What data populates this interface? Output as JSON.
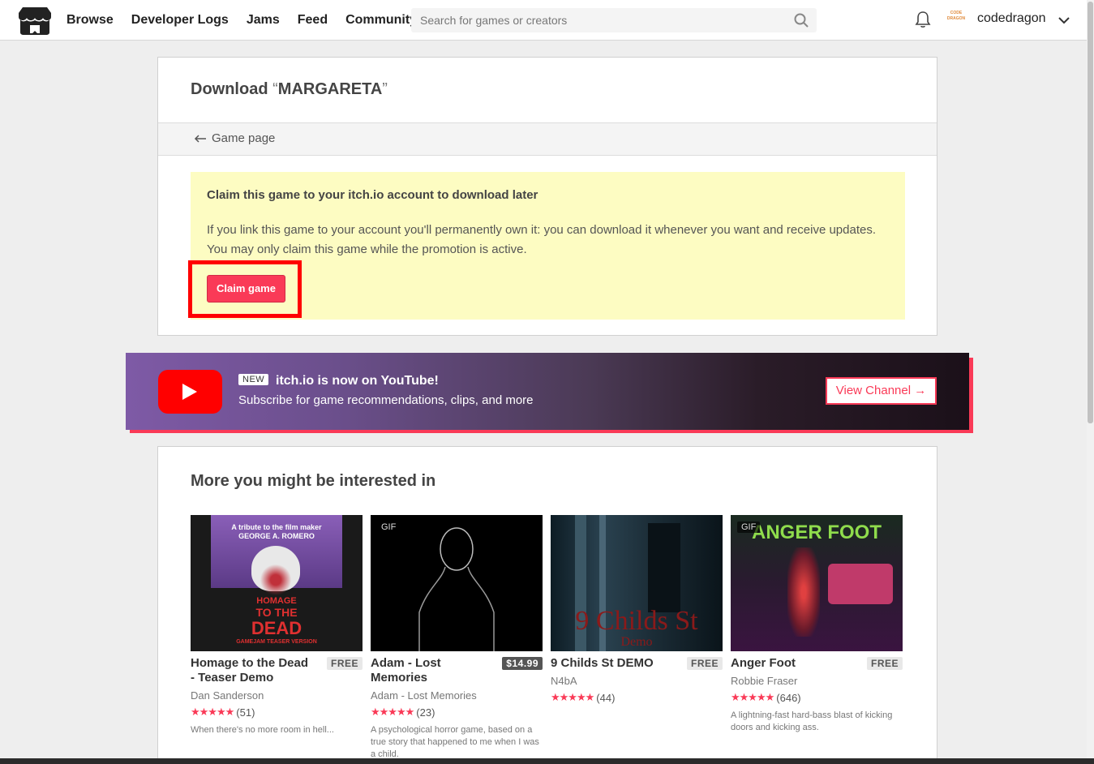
{
  "header": {
    "nav": [
      "Browse",
      "Developer Logs",
      "Jams",
      "Feed",
      "Community"
    ],
    "search_placeholder": "Search for games or creators",
    "username": "codedragon",
    "avatar_text": "CODE DRAGON"
  },
  "download": {
    "title_prefix": "Download ",
    "open_quote": "“",
    "game_name": "MARGARETA",
    "close_quote": "”",
    "back_link": "Game page",
    "claim_heading": "Claim this game to your itch.io account to download later",
    "claim_text": "If you link this game to your account you'll permanently own it: you can download it whenever you want and receive updates. You may only claim this game while the promotion is active.",
    "claim_button": "Claim game"
  },
  "youtube": {
    "badge": "NEW",
    "heading": "itch.io is now on YouTube!",
    "subtext": "Subscribe for game recommendations, clips, and more",
    "button": "View Channel →"
  },
  "more": {
    "title": "More you might be interested in",
    "games": [
      {
        "title": "Homage to the Dead - Teaser Demo",
        "price": "FREE",
        "author": "Dan Sanderson",
        "rating_count": "(51)",
        "rating": 4.5,
        "description": "When there's no more room in hell...",
        "gif": "",
        "cover_line1": "A tribute to the film maker",
        "cover_line2": "GEORGE A. ROMERO",
        "cover_title1": "HOMAGE",
        "cover_title2": "TO THE",
        "cover_title3": "DEAD",
        "cover_footer": "GAMEJAM TEASER VERSION"
      },
      {
        "title": "Adam - Lost Memories",
        "price": "$14.99",
        "author": "Adam - Lost Memories",
        "rating_count": "(23)",
        "rating": 5,
        "description": "A psychological horror game, based on a true story that happened to me when I was a child.",
        "gif": "GIF"
      },
      {
        "title": "9 Childs St DEMO",
        "price": "FREE",
        "author": "N4bA",
        "rating_count": "(44)",
        "rating": 4.5,
        "description": "",
        "gif": "",
        "cover_title": "9 Childs St",
        "cover_sub": "Demo"
      },
      {
        "title": "Anger Foot",
        "price": "FREE",
        "author": "Robbie Fraser",
        "rating_count": "(646)",
        "rating": 5,
        "description": "A lightning-fast hard-bass blast of kicking doors and kicking ass.",
        "gif": "GIF",
        "cover_title": "ANGER FOOT"
      }
    ]
  },
  "colors": {
    "accent": "#fa3a57",
    "claim_bg": "#fdfcc2",
    "highlight": "#ff0000",
    "youtube_red": "#ff0000"
  }
}
